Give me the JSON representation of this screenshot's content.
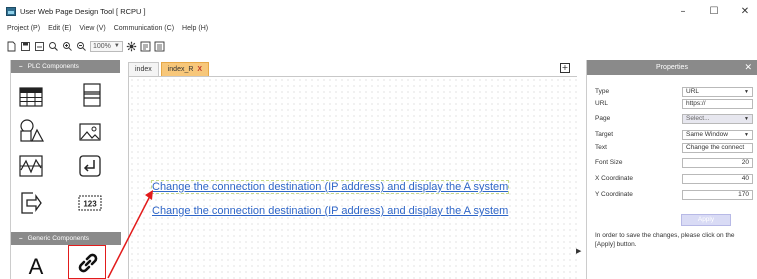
{
  "window": {
    "title": "User Web Page Design Tool [ RCPU ]",
    "minimize_glyph": "–",
    "maximize_glyph": "☐",
    "close_glyph": "✕"
  },
  "menu": [
    {
      "label": "Project (P)"
    },
    {
      "label": "Edit (E)"
    },
    {
      "label": "View (V)"
    },
    {
      "label": "Communication (C)"
    },
    {
      "label": "Help (H)"
    }
  ],
  "toolbar": {
    "icons": [
      "new-file-icon",
      "save-icon",
      "open-icon",
      "search-icon",
      "zoom-in-icon",
      "zoom-out-icon"
    ],
    "zoom_value": "100%",
    "extra_icons": [
      "settings-icon",
      "download-icon",
      "upload-icon"
    ]
  },
  "sidebar": {
    "plc_header": "PLC Components",
    "generic_header": "Generic Components",
    "collapse_glyph": "–",
    "plc_components": [
      "table-icon",
      "list-icon",
      "shapes-icon",
      "image-icon",
      "graph-icon",
      "enter-icon",
      "export-icon",
      "numeric-display-icon"
    ],
    "numeric_label": "123",
    "generic_components": [
      "text-icon",
      "link-icon"
    ],
    "text_glyph": "A"
  },
  "tabs": [
    {
      "label": "index",
      "active": false
    },
    {
      "label": "index_R",
      "active": true,
      "close": "X"
    }
  ],
  "canvas": {
    "links": [
      {
        "text": "Change the connection destination (IP address) and display the A system",
        "selected": true
      },
      {
        "text": "Change the connection destination (IP address) and display the A system",
        "selected": false
      }
    ]
  },
  "properties": {
    "title": "Properties",
    "close": "✕",
    "rows": [
      {
        "label": "Type",
        "value": "URL",
        "kind": "select"
      },
      {
        "label": "URL",
        "value": "https://",
        "kind": "input"
      },
      {
        "label": "Page",
        "value": "Select...",
        "kind": "select-disabled"
      },
      {
        "label": "Target",
        "value": "Same Window",
        "kind": "select"
      },
      {
        "label": "Text",
        "value": "Change the connect",
        "kind": "input"
      },
      {
        "label": "Font Size",
        "value": "20",
        "kind": "num"
      },
      {
        "label": "X Coordinate",
        "value": "40",
        "kind": "num"
      },
      {
        "label": "Y Coordinate",
        "value": "170",
        "kind": "num"
      }
    ],
    "apply_label": "Apply",
    "note": "In order to save the changes, please click on the [Apply] button."
  },
  "colors": {
    "header_gray": "#8a8a8a",
    "active_tab": "#f7c77a",
    "link_blue": "#2f66c8",
    "annotation_red": "#e21b1b"
  }
}
